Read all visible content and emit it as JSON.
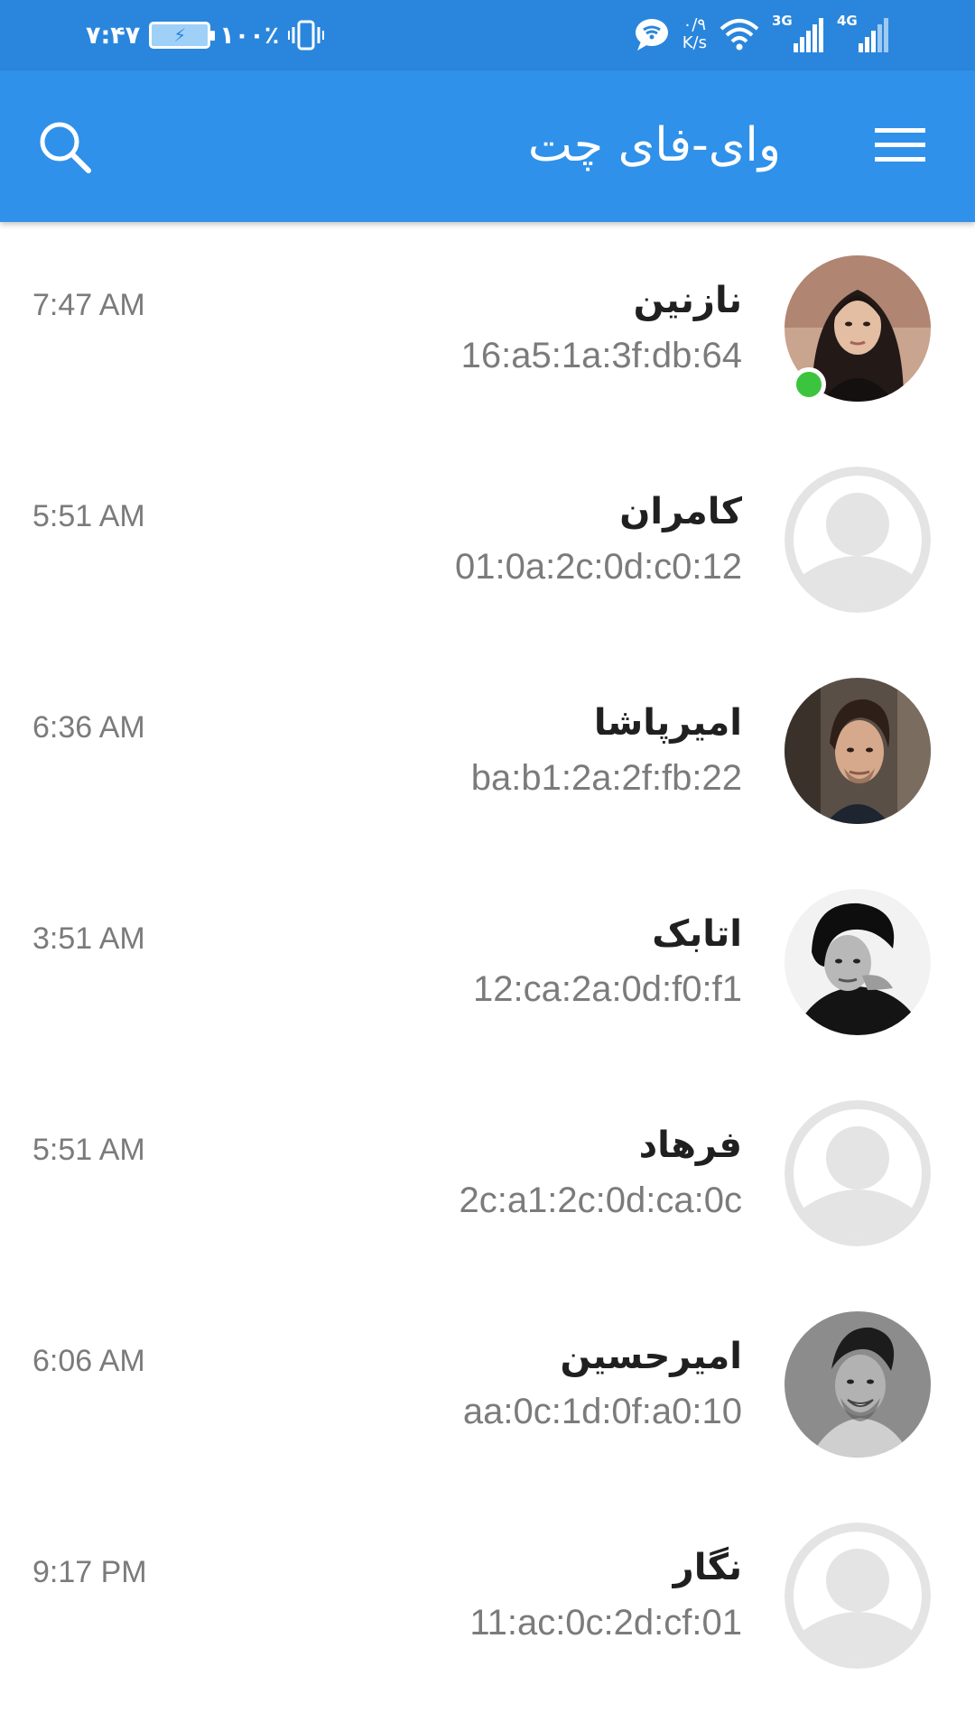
{
  "status_bar": {
    "time": "۷:۴۷",
    "battery_percent": "۱۰۰٪",
    "net_speed_value": "۰/۹",
    "net_speed_unit": "K/s",
    "sim1_label": "3G",
    "sim2_label": "4G"
  },
  "app_bar": {
    "title": "وای-فای چت",
    "search_icon": "search-icon",
    "menu_icon": "menu-icon",
    "color": "#2f91e9"
  },
  "chats": [
    {
      "name": "نازنین",
      "mac": "16:a5:1a:3f:db:64",
      "time": "7:47 AM",
      "avatar": "photo-woman",
      "online": true
    },
    {
      "name": "کامران",
      "mac": "01:0a:2c:0d:c0:12",
      "time": "5:51 AM",
      "avatar": "placeholder",
      "online": false
    },
    {
      "name": "امیرپاشا",
      "mac": "ba:b1:2a:2f:fb:22",
      "time": "6:36 AM",
      "avatar": "photo-man",
      "online": false
    },
    {
      "name": "اتابک",
      "mac": "12:ca:2a:0d:f0:f1",
      "time": "3:51 AM",
      "avatar": "photo-man-bw",
      "online": false
    },
    {
      "name": "فرهاد",
      "mac": "2c:a1:2c:0d:ca:0c",
      "time": "5:51 AM",
      "avatar": "placeholder",
      "online": false
    },
    {
      "name": "امیرحسین",
      "mac": "aa:0c:1d:0f:a0:10",
      "time": "6:06 AM",
      "avatar": "photo-man-bw-smile",
      "online": false
    },
    {
      "name": "نگار",
      "mac": "11:ac:0c:2d:cf:01",
      "time": "9:17 PM",
      "avatar": "placeholder",
      "online": false
    }
  ],
  "colors": {
    "status_bar": "#2a86dc",
    "online": "#3cc43e",
    "placeholder_avatar": "#e4e4e4",
    "secondary_text": "#7b7b7b"
  }
}
